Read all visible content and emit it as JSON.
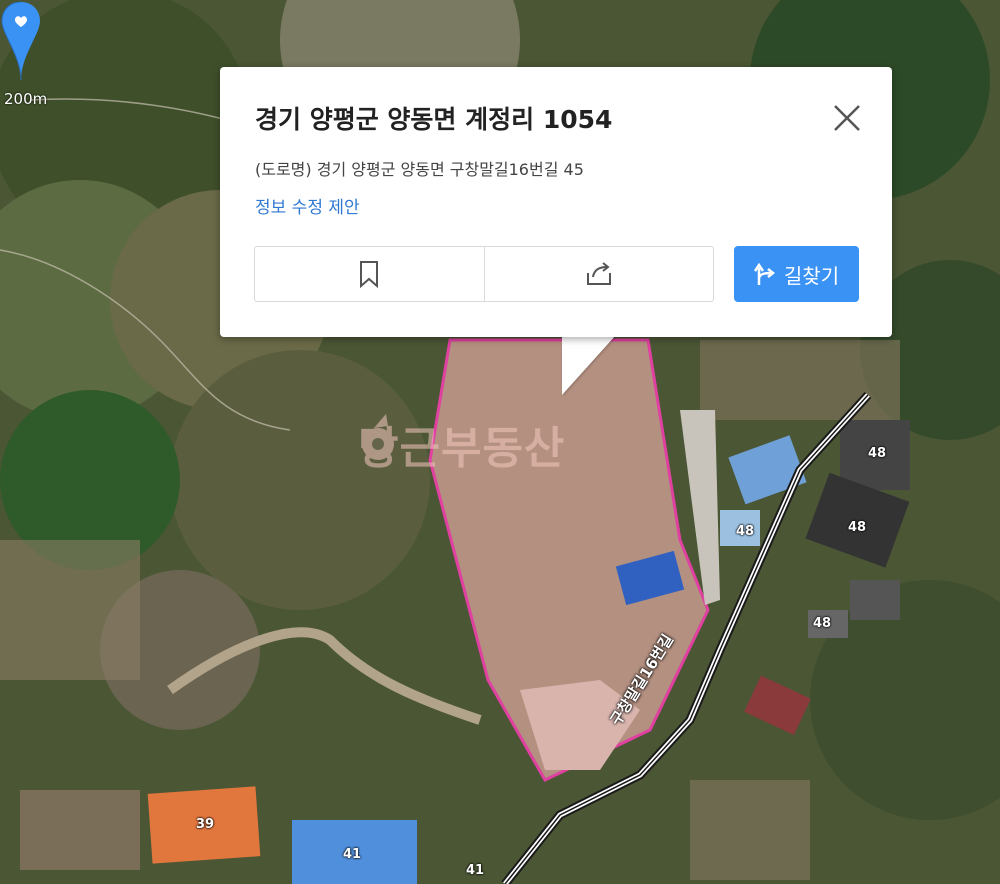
{
  "map": {
    "scale_label": "200m",
    "road_label": "구창말길16번길",
    "watermark": "당근부동산",
    "building_numbers": [
      "48",
      "48",
      "48",
      "48",
      "39",
      "41",
      "41"
    ],
    "parcel_color": "#e040a0"
  },
  "popup": {
    "title": "경기 양평군 양동면 계정리 1054",
    "road_address": "(도로명) 경기 양평군 양동면 구창말길16번길 45",
    "edit_link": "정보 수정 제안",
    "route_button": "길찾기",
    "accent_color": "#3a92f5"
  },
  "icons": {
    "close": "close-icon",
    "bookmark": "bookmark-icon",
    "share": "share-icon",
    "route": "route-icon",
    "marker": "location-marker-icon"
  }
}
